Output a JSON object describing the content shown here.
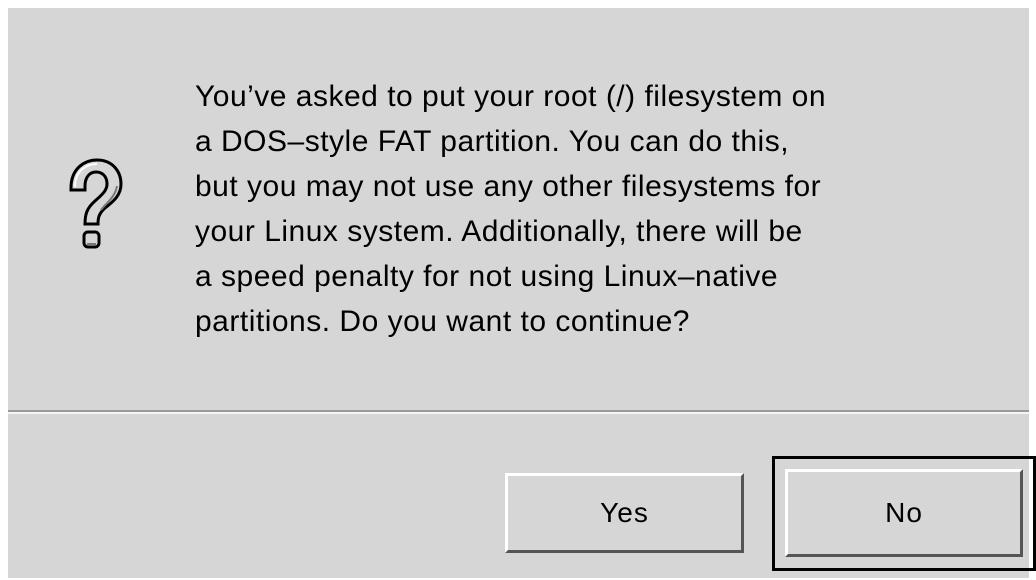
{
  "dialog": {
    "icon": "question-mark-icon",
    "message_lines": [
      "You’ve asked to put your root (/) filesystem on",
      "a DOS–style FAT partition. You can do this,",
      "but you may not use any other filesystems for",
      "your Linux system. Additionally, there will be",
      "a speed penalty for not using Linux–native",
      "partitions. Do you want to continue?"
    ],
    "buttons": {
      "yes_label": "Yes",
      "no_label": "No"
    },
    "default_button": "No",
    "colors": {
      "background": "#d6d6d6",
      "text": "#000000"
    }
  }
}
